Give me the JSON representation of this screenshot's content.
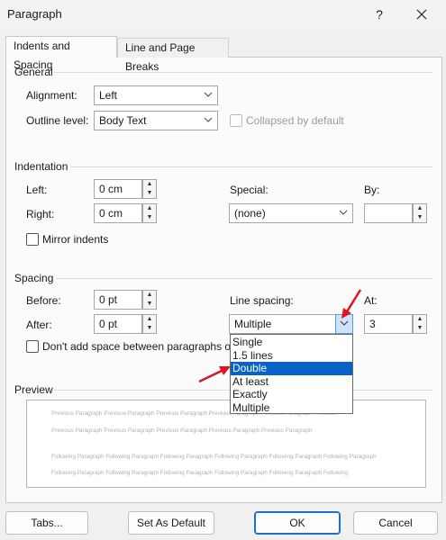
{
  "window": {
    "title": "Paragraph",
    "help_glyph": "?",
    "close_glyph": "✕"
  },
  "tabs": [
    {
      "label": "Indents and Spacing",
      "active": true
    },
    {
      "label": "Line and Page Breaks",
      "active": false
    }
  ],
  "general": {
    "heading": "General",
    "alignment": {
      "label": "Alignment:",
      "value": "Left"
    },
    "outline_level": {
      "label": "Outline level:",
      "value": "Body Text"
    },
    "collapsed": {
      "label": "Collapsed by default",
      "checked": false,
      "enabled": false
    }
  },
  "indentation": {
    "heading": "Indentation",
    "left": {
      "label": "Left:",
      "value": "0 cm"
    },
    "right": {
      "label": "Right:",
      "value": "0 cm"
    },
    "special": {
      "label": "Special:",
      "value": "(none)"
    },
    "by": {
      "label": "By:",
      "value": ""
    },
    "mirror": {
      "label": "Mirror indents",
      "checked": false
    }
  },
  "spacing": {
    "heading": "Spacing",
    "before": {
      "label": "Before:",
      "value": "0 pt"
    },
    "after": {
      "label": "After:",
      "value": "0 pt"
    },
    "line_spacing": {
      "label": "Line spacing:",
      "value": "Multiple"
    },
    "at": {
      "label": "At:",
      "value": "3"
    },
    "dont_add": {
      "label": "Don't add space between paragraphs of",
      "checked": false
    },
    "options": [
      "Single",
      "1.5 lines",
      "Double",
      "At least",
      "Exactly",
      "Multiple"
    ],
    "highlighted_option": "Double"
  },
  "preview": {
    "heading": "Preview",
    "prev_line_1": "Previous Paragraph Previous Paragraph Previous Paragraph Previous Paragraph Previous Paragraph Previous",
    "prev_line_2": "Previous Paragraph Previous Paragraph Previous Paragraph Previous Paragraph Previous Paragraph",
    "follow_line_1": "Following Paragraph Following Paragraph Following Paragraph Following Paragraph Following Paragraph Following Paragraph",
    "follow_line_2": "Following Paragraph Following Paragraph Following Paragraph Following Paragraph Following Paragraph Following"
  },
  "buttons": {
    "tabs": "Tabs...",
    "set_default": "Set As Default",
    "ok": "OK",
    "cancel": "Cancel"
  },
  "colors": {
    "accent": "#0a62c7",
    "annotation_arrow": "#e0141e"
  }
}
